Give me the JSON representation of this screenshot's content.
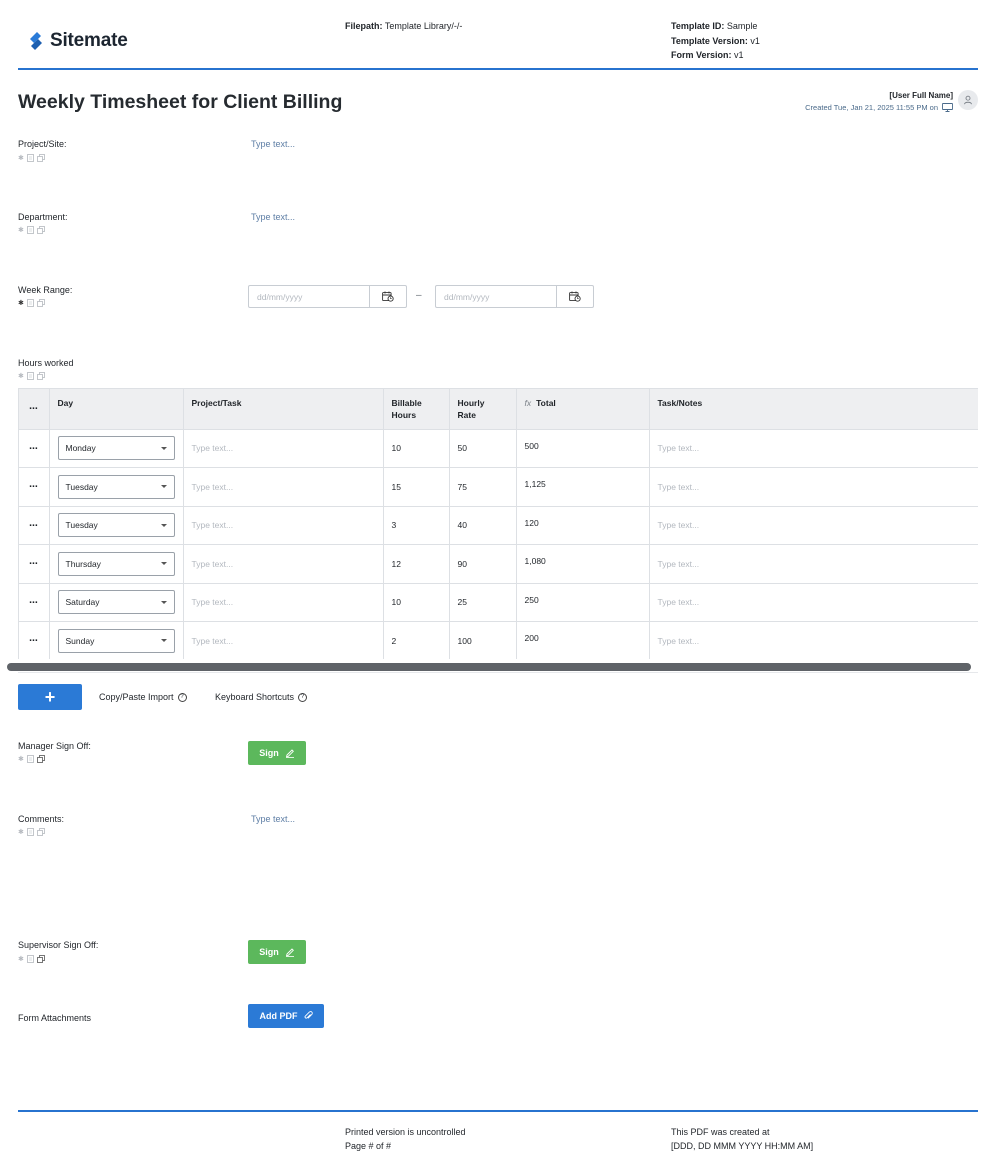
{
  "header": {
    "logo_text": "Sitemate",
    "filepath_label": "Filepath:",
    "filepath_value": "Template Library/-/-",
    "template_id_label": "Template ID:",
    "template_id_value": "Sample",
    "template_version_label": "Template Version:",
    "template_version_value": "v1",
    "form_version_label": "Form Version:",
    "form_version_value": "v1",
    "accent_color": "#2773cf"
  },
  "form": {
    "title": "Weekly Timesheet for Client Billing",
    "user_name": "[User Full Name]",
    "created": "Created Tue, Jan 21, 2025 11:55 PM on",
    "fields": {
      "project_site": {
        "label": "Project/Site:",
        "placeholder": "Type text..."
      },
      "department": {
        "label": "Department:",
        "placeholder": "Type text..."
      },
      "week_range": {
        "label": "Week Range:",
        "start_placeholder": "dd/mm/yyyy",
        "separator": "–",
        "end_placeholder": "dd/mm/yyyy"
      },
      "hours_worked": {
        "label": "Hours worked"
      },
      "manager_sign_off": {
        "label": "Manager Sign Off:",
        "button": "Sign"
      },
      "comments": {
        "label": "Comments:",
        "placeholder": "Type text..."
      },
      "supervisor_sign_off": {
        "label": "Supervisor Sign Off:",
        "button": "Sign"
      },
      "attachments": {
        "label": "Form Attachments",
        "button": "Add PDF"
      }
    }
  },
  "table": {
    "columns": {
      "menu": "⋯",
      "day": "Day",
      "project": "Project/Task",
      "billable": "Billable Hours",
      "rate": "Hourly Rate",
      "fx": "fx",
      "total": "Total",
      "notes": "Task/Notes"
    },
    "cell_placeholder": "Type text...",
    "rows": [
      {
        "day": "Monday",
        "billable": "10",
        "rate": "50",
        "total": "500"
      },
      {
        "day": "Tuesday",
        "billable": "15",
        "rate": "75",
        "total": "1,125"
      },
      {
        "day": "Tuesday",
        "billable": "3",
        "rate": "40",
        "total": "120"
      },
      {
        "day": "Thursday",
        "billable": "12",
        "rate": "90",
        "total": "1,080"
      },
      {
        "day": "Saturday",
        "billable": "10",
        "rate": "25",
        "total": "250"
      },
      {
        "day": "Sunday",
        "billable": "2",
        "rate": "100",
        "total": "200"
      }
    ]
  },
  "actions": {
    "add_row": "+",
    "copy_paste_import": "Copy/Paste Import",
    "keyboard_shortcuts": "Keyboard Shortcuts",
    "help": "?"
  },
  "footer": {
    "uncontrolled": "Printed version is uncontrolled",
    "page": "Page # of #",
    "created_label": "This PDF was created at",
    "created_value": "[DDD, DD MMM YYYY HH:MM AM]"
  },
  "colors": {
    "primary_blue": "#2b7ad6",
    "sign_green": "#5cb85c",
    "placeholder_link": "#5f7fa6"
  }
}
